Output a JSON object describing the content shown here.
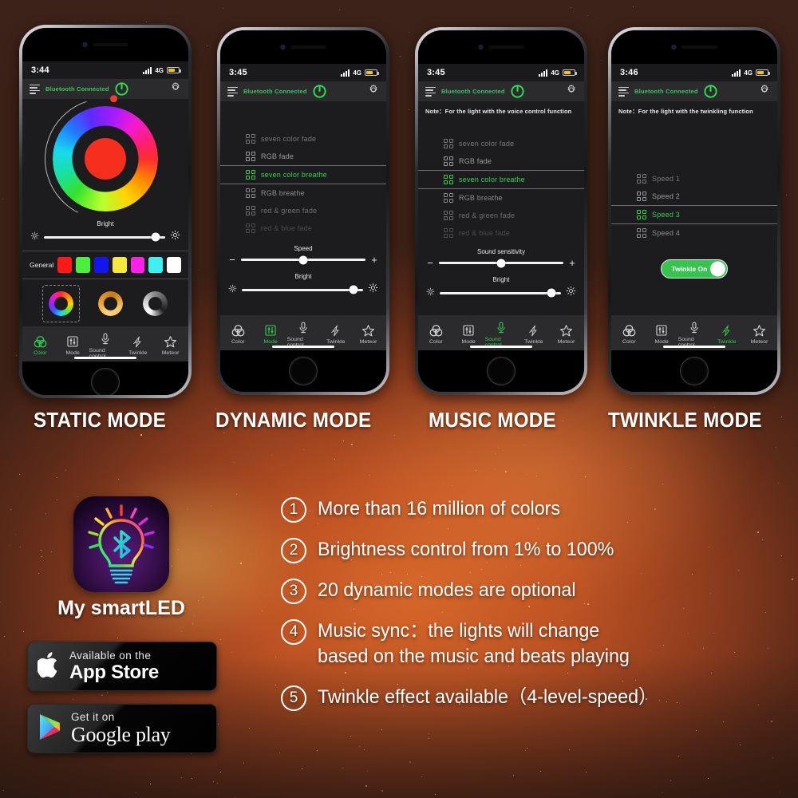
{
  "phones": [
    {
      "caption": "STATIC MODE",
      "status": {
        "time": "3:44",
        "network": "4G"
      },
      "appbar": {
        "bluetooth": "Bluetooth Connected",
        "menu_icon": "menu-icon",
        "power_icon": "power-icon",
        "gear_icon": "gear-icon"
      },
      "note": "",
      "wheel": {
        "selected_color": "#f52e1d",
        "knob_color": "#f6392c"
      },
      "sliders": [
        {
          "label": "Bright",
          "value": 92,
          "left_icon": "brightness-low-icon",
          "right_icon": "brightness-high-icon"
        }
      ],
      "general": {
        "label": "General",
        "swatches": [
          "#ff1a1a",
          "#4cf03c",
          "#1414f0",
          "#f5ea3c",
          "#ff20e8",
          "#3ff0f0",
          "#ffffff"
        ]
      },
      "presets": [
        "rainbow-ring-preset",
        "amber-ring-preset",
        "white-ring-preset"
      ],
      "tabs": [
        {
          "label": "Color",
          "icon": "color-rings-icon",
          "active": true
        },
        {
          "label": "Mode",
          "icon": "sliders-icon",
          "active": false
        },
        {
          "label": "Sound control",
          "icon": "microphone-icon",
          "active": false
        },
        {
          "label": "Twinkle",
          "icon": "lightning-icon",
          "active": false
        },
        {
          "label": "Meteor",
          "icon": "star-icon",
          "active": false
        }
      ]
    },
    {
      "caption": "DYNAMIC MODE",
      "status": {
        "time": "3:45",
        "network": "4G"
      },
      "appbar": {
        "bluetooth": "Bluetooth Connected",
        "menu_icon": "menu-icon",
        "power_icon": "power-icon",
        "gear_icon": "gear-icon"
      },
      "note": "",
      "modes": [
        {
          "label": "seven color fade",
          "state": "dim1"
        },
        {
          "label": "RGB fade",
          "state": "dim2"
        },
        {
          "label": "seven color breathe",
          "state": "selected"
        },
        {
          "label": "RGB breathe",
          "state": "dim3"
        },
        {
          "label": "red & green fade",
          "state": "dim4"
        },
        {
          "label": "red & blue fade",
          "state": "dim5"
        }
      ],
      "sliders": [
        {
          "label": "Speed",
          "value": 50,
          "left_icon": "minus-icon",
          "right_icon": "plus-icon"
        },
        {
          "label": "Bright",
          "value": 92,
          "left_icon": "brightness-low-icon",
          "right_icon": "brightness-high-icon"
        }
      ],
      "tabs": [
        {
          "label": "Color",
          "icon": "color-rings-icon",
          "active": false
        },
        {
          "label": "Mode",
          "icon": "sliders-icon",
          "active": true
        },
        {
          "label": "Sound control",
          "icon": "microphone-icon",
          "active": false
        },
        {
          "label": "Twinkle",
          "icon": "lightning-icon",
          "active": false
        },
        {
          "label": "Meteor",
          "icon": "star-icon",
          "active": false
        }
      ]
    },
    {
      "caption": "MUSIC MODE",
      "status": {
        "time": "3:45",
        "network": "4G"
      },
      "appbar": {
        "bluetooth": "Bluetooth Connected",
        "menu_icon": "menu-icon",
        "power_icon": "power-icon",
        "gear_icon": "gear-icon"
      },
      "note": "Note：For the light with the voice control function",
      "modes": [
        {
          "label": "seven color fade",
          "state": "dim1"
        },
        {
          "label": "RGB fade",
          "state": "dim2"
        },
        {
          "label": "seven color breathe",
          "state": "selected"
        },
        {
          "label": "RGB breathe",
          "state": "dim3"
        },
        {
          "label": "red & green fade",
          "state": "dim4"
        },
        {
          "label": "red & blue fade",
          "state": "dim5"
        }
      ],
      "sliders": [
        {
          "label": "Sound sensitivity",
          "value": 50,
          "left_icon": "minus-icon",
          "right_icon": "plus-icon"
        },
        {
          "label": "Bright",
          "value": 92,
          "left_icon": "brightness-low-icon",
          "right_icon": "brightness-high-icon"
        }
      ],
      "tabs": [
        {
          "label": "Color",
          "icon": "color-rings-icon",
          "active": false
        },
        {
          "label": "Mode",
          "icon": "sliders-icon",
          "active": false
        },
        {
          "label": "Sound control",
          "icon": "microphone-icon",
          "active": true
        },
        {
          "label": "Twinkle",
          "icon": "lightning-icon",
          "active": false
        },
        {
          "label": "Meteor",
          "icon": "star-icon",
          "active": false
        }
      ]
    },
    {
      "caption": "TWINKLE MODE",
      "status": {
        "time": "3:46",
        "network": "4G"
      },
      "appbar": {
        "bluetooth": "Bluetooth Connected",
        "menu_icon": "menu-icon",
        "power_icon": "power-icon",
        "gear_icon": "gear-icon"
      },
      "note": "Note：For the light with the twinkling function",
      "modes": [
        {
          "label": "Speed 1",
          "state": "dim1"
        },
        {
          "label": "Speed 2",
          "state": "dim2"
        },
        {
          "label": "Speed 3",
          "state": "selected"
        },
        {
          "label": "Speed 4",
          "state": "dim3"
        }
      ],
      "toggle": {
        "label": "Twinkle On",
        "on": true,
        "color": "#36c34f"
      },
      "tabs": [
        {
          "label": "Color",
          "icon": "color-rings-icon",
          "active": false
        },
        {
          "label": "Mode",
          "icon": "sliders-icon",
          "active": false
        },
        {
          "label": "Sound control",
          "icon": "microphone-icon",
          "active": false
        },
        {
          "label": "Twinkle",
          "icon": "lightning-icon",
          "active": true
        },
        {
          "label": "Meteor",
          "icon": "star-icon",
          "active": false
        }
      ]
    }
  ],
  "app": {
    "icon_name": "smartled-bulb-bluetooth-icon",
    "name": "My smartLED"
  },
  "stores": [
    {
      "small": "Available on the",
      "big": "App Store",
      "icon": "apple-logo-icon"
    },
    {
      "small": "Get it on",
      "big": "Google play",
      "icon": "google-play-triangle-icon"
    }
  ],
  "features": [
    {
      "num": "①",
      "line1": "More than 16 million of colors",
      "line2": ""
    },
    {
      "num": "②",
      "line1": "Brightness control from 1% to 100%",
      "line2": ""
    },
    {
      "num": "③",
      "line1": "20 dynamic modes are optional",
      "line2": ""
    },
    {
      "num": "④",
      "line1": "Music sync：the lights will change",
      "line2": "based on the music and beats playing"
    },
    {
      "num": "⑤",
      "line1": "Twinkle effect available（4-level-speed）",
      "line2": ""
    }
  ],
  "colors": {
    "accent_green": "#2fd14f",
    "background_orange": "#bc5223",
    "screen_bg": "#1c1c1e",
    "bar_bg": "#2b2b2d"
  }
}
